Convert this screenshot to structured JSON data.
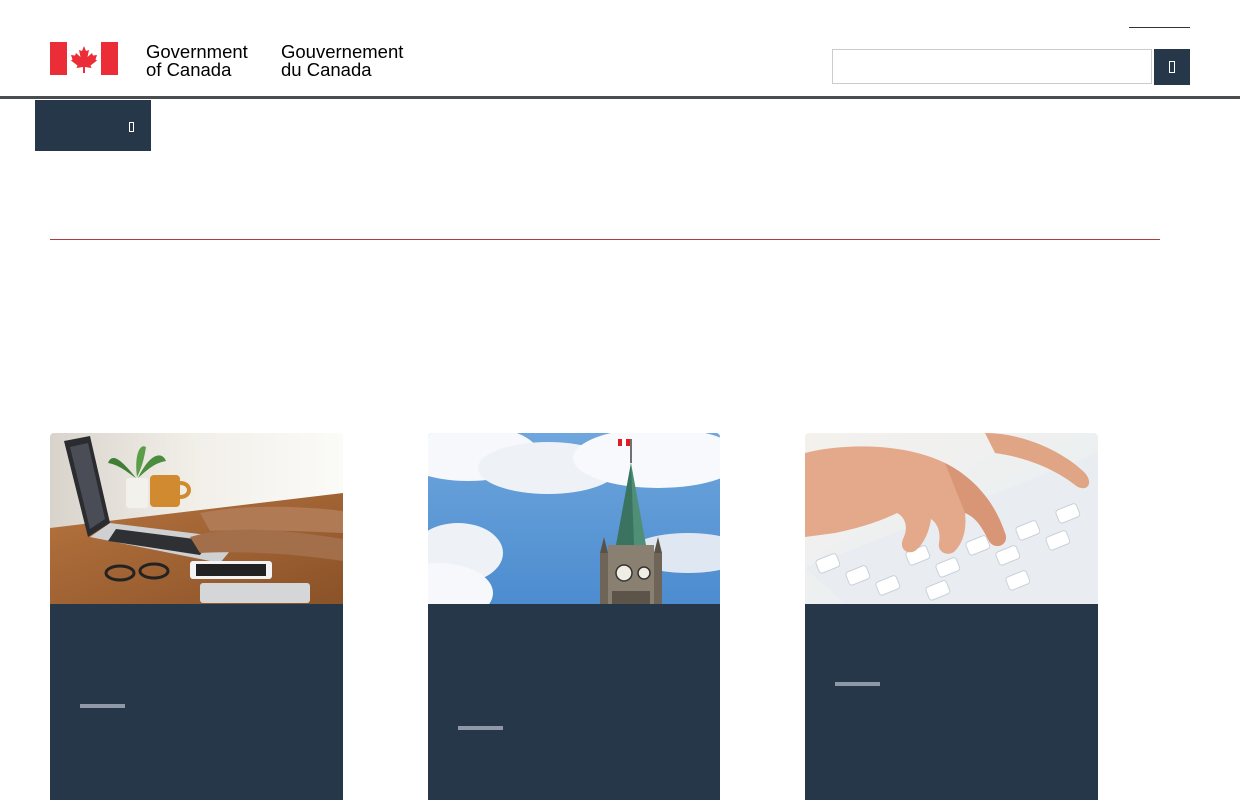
{
  "header": {
    "signature_en_line1": "Government",
    "signature_en_line2": "of Canada",
    "signature_fr_line1": "Gouvernement",
    "signature_fr_line2": "du Canada",
    "language_link": "",
    "search_placeholder": "",
    "search_icon": "search-icon"
  },
  "menu": {
    "label": "",
    "icon": "chevron-down-icon"
  },
  "page": {
    "title": ""
  },
  "cards": [
    {
      "image": "laptop-desk-photo",
      "title": ""
    },
    {
      "image": "peace-tower-photo",
      "title": ""
    },
    {
      "image": "keyboard-hands-photo",
      "title": ""
    }
  ],
  "colors": {
    "brand_navy": "#26374a",
    "header_rule": "#4a4d50",
    "title_rule": "#af3c43",
    "flag_red": "#eb2d37",
    "card_dash": "#8e98a6"
  }
}
